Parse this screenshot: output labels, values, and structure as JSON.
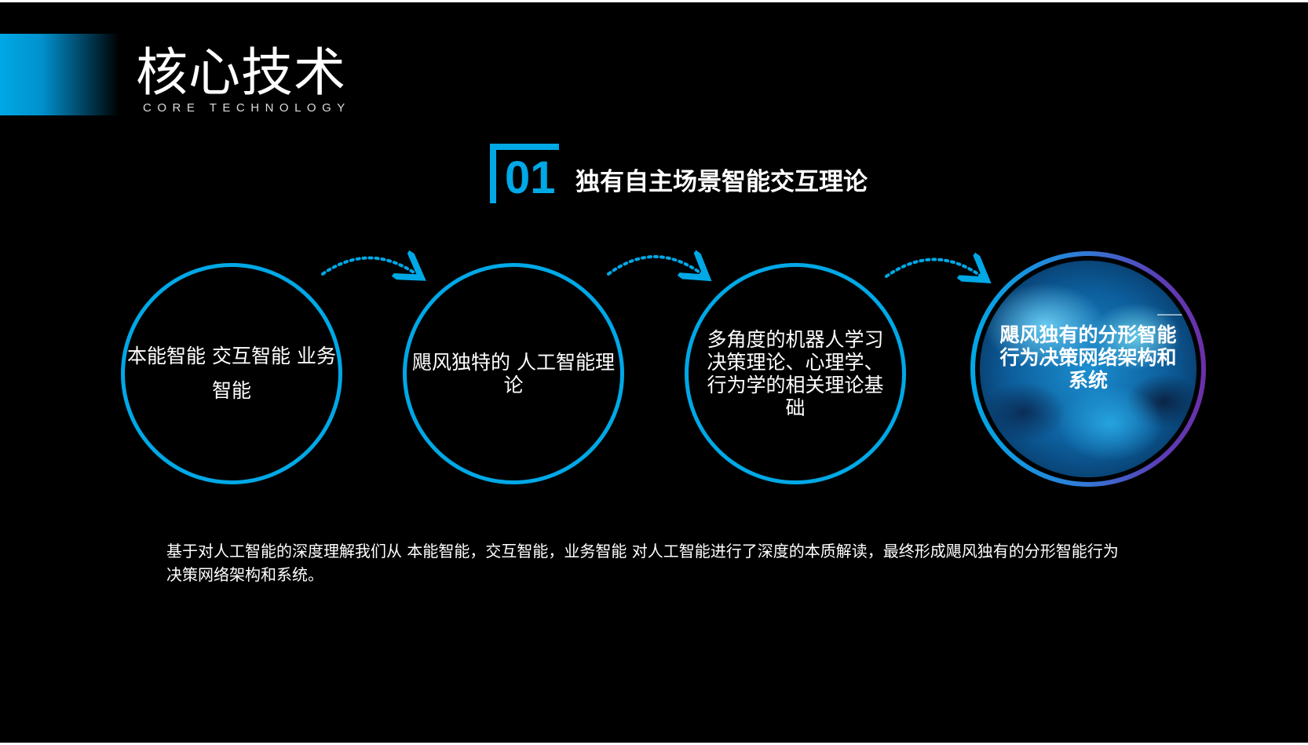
{
  "colors": {
    "accent": "#00a8e6",
    "background": "#000000",
    "text": "#ffffff",
    "ring_gradient_end": "#6b2fa8"
  },
  "header": {
    "title": "核心技术",
    "subtitle": "CORE TECHNOLOGY"
  },
  "section": {
    "number": "01",
    "title": "独有自主场景智能交互理论"
  },
  "circles": [
    {
      "lines": [
        "本能智能",
        "交互智能",
        "业务智能"
      ]
    },
    {
      "lines": [
        "飓风独特的",
        "人工智能理论"
      ]
    },
    {
      "text": "多角度的机器人学习决策理论、心理学、行为学的相关理论基础"
    },
    {
      "text": "飓风独有的分形智能行为决策网络架构和系统",
      "image": "nebula-texture"
    }
  ],
  "arrows": [
    "dotted-curved-arrow",
    "dotted-curved-arrow",
    "dotted-curved-arrow"
  ],
  "description": "基于对人工智能的深度理解我们从 本能智能，交互智能，业务智能 对人工智能进行了深度的本质解读，最终形成飓风独有的分形智能行为决策网络架构和系统。"
}
